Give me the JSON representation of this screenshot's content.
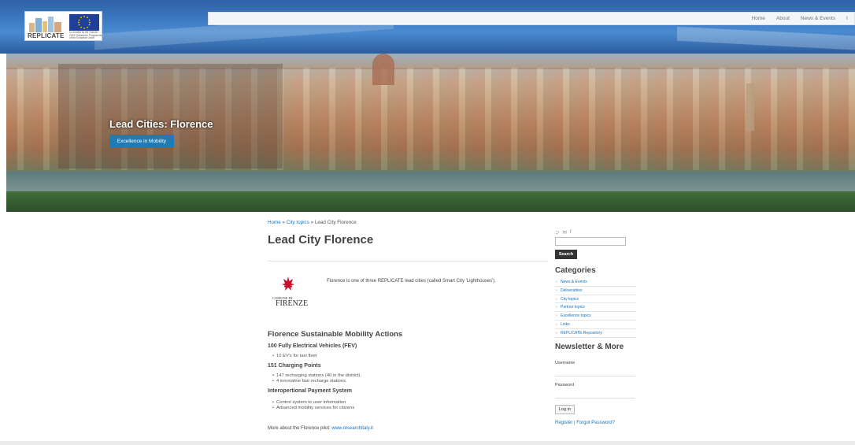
{
  "header": {
    "logo_text": "REPLICATE",
    "eu_caption": "Co-funded by the Horizon 2020 Framework Programme of the European Union",
    "nav": [
      "Home",
      "About",
      "News & Events",
      "I"
    ]
  },
  "hero": {
    "title": "Lead Cities: Florence",
    "button": "Excellence in Mobility"
  },
  "breadcrumb": {
    "home": "Home",
    "sep1": "»",
    "city_topics": "City topics",
    "sep2": "»",
    "current": "Lead City Florence"
  },
  "main": {
    "title": "Lead City Florence",
    "logo_top": "COMUNE DI",
    "logo_bottom": "FIRENZE",
    "intro": "Florence is one of three REPLICATE lead cities (called Smart City 'Lighthouses').",
    "mobility_title": "Florence Sustainable Mobility Actions",
    "sections": [
      {
        "title": "100 Fully Electrical Vehicles (FEV)",
        "bullets": [
          "10 EV's for taxi fleet"
        ]
      },
      {
        "title": "151 Charging Points",
        "bullets": [
          "147 recharging stations (40 in the district).",
          "4 innovative fast recharge stations."
        ]
      },
      {
        "title": "Interopertional Payment System",
        "bullets": [
          "Control system to user information",
          "Advanced mobility services for citizens"
        ]
      }
    ],
    "more_text": "More about the Florence pilot:",
    "more_link": "www.researchitaly.it"
  },
  "sidebar": {
    "social_icons": [
      "rss-icon",
      "mail-icon",
      "facebook-icon"
    ],
    "social_glyphs": [
      "⊃",
      "✉",
      "f"
    ],
    "search_value": "",
    "search_button": "Search",
    "categories_title": "Categories",
    "categories": [
      "News & Events",
      "Deliverables",
      "City topics",
      "Partner topics",
      "Excellence topics",
      "Links",
      "REPLICATE Repository"
    ],
    "newsletter_title": "Newsletter & More",
    "username_label": "Username",
    "password_label": "Password",
    "login_button": "Log in",
    "register_link": "Register",
    "links_sep": "|",
    "forgot_link": "Forgot Password?"
  },
  "colors": {
    "accent": "#1f7bb5",
    "link": "#1a73b8",
    "header_blue": "#3b78bf"
  }
}
